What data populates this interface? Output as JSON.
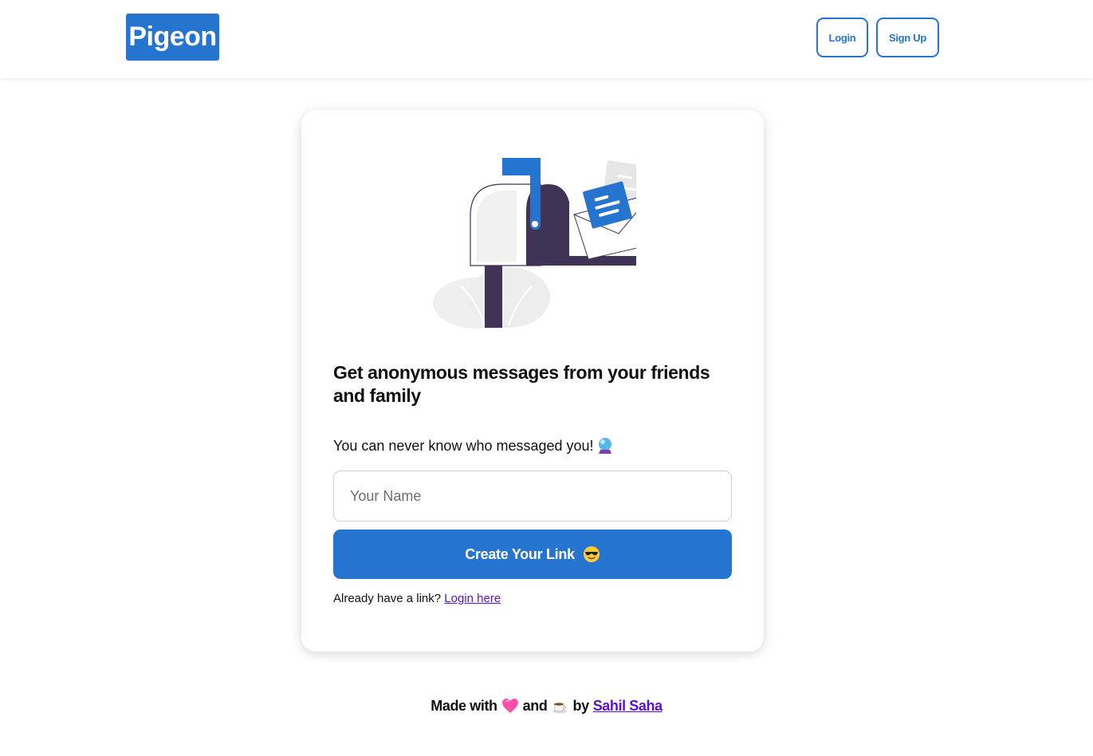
{
  "navbar": {
    "brand": "Pigeon",
    "login_label": "Login",
    "signup_label": "Sign Up"
  },
  "card": {
    "headline": "Get anonymous messages from your friends and family",
    "subline": "You can never know who messaged you!",
    "subline_icon": "crystal-ball-icon",
    "name_placeholder": "Your Name",
    "name_value": "",
    "create_label": "Create Your Link",
    "create_icon": "sunglasses-face-icon",
    "already_text": "Already have a link?",
    "login_link": "Login here"
  },
  "footer": {
    "made_with": "Made with",
    "heart_icon": "heart-icon",
    "and": "and",
    "coffee_icon": "coffee-icon",
    "by": "by",
    "author": "Sahil Saha"
  },
  "colors": {
    "accent": "#2575d0",
    "link": "#5a0fd8",
    "mailbox_dark": "#3f3356"
  }
}
